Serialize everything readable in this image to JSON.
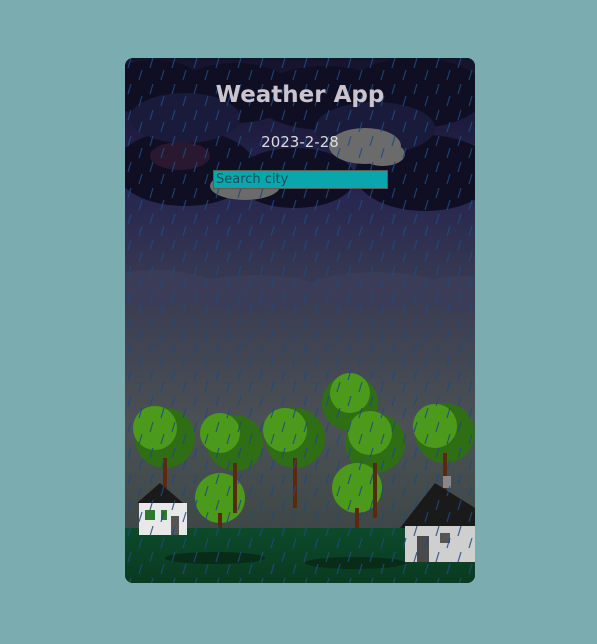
{
  "app": {
    "title": "Weather App",
    "date": "2023-2-28"
  },
  "search": {
    "placeholder": "Search city",
    "value": ""
  },
  "colors": {
    "page_background": "#7aacb0",
    "search_background": "#0aa6ad",
    "title_text": "#c9c4cd"
  },
  "background": {
    "scene": "rainy night with storm clouds, trees and houses"
  }
}
